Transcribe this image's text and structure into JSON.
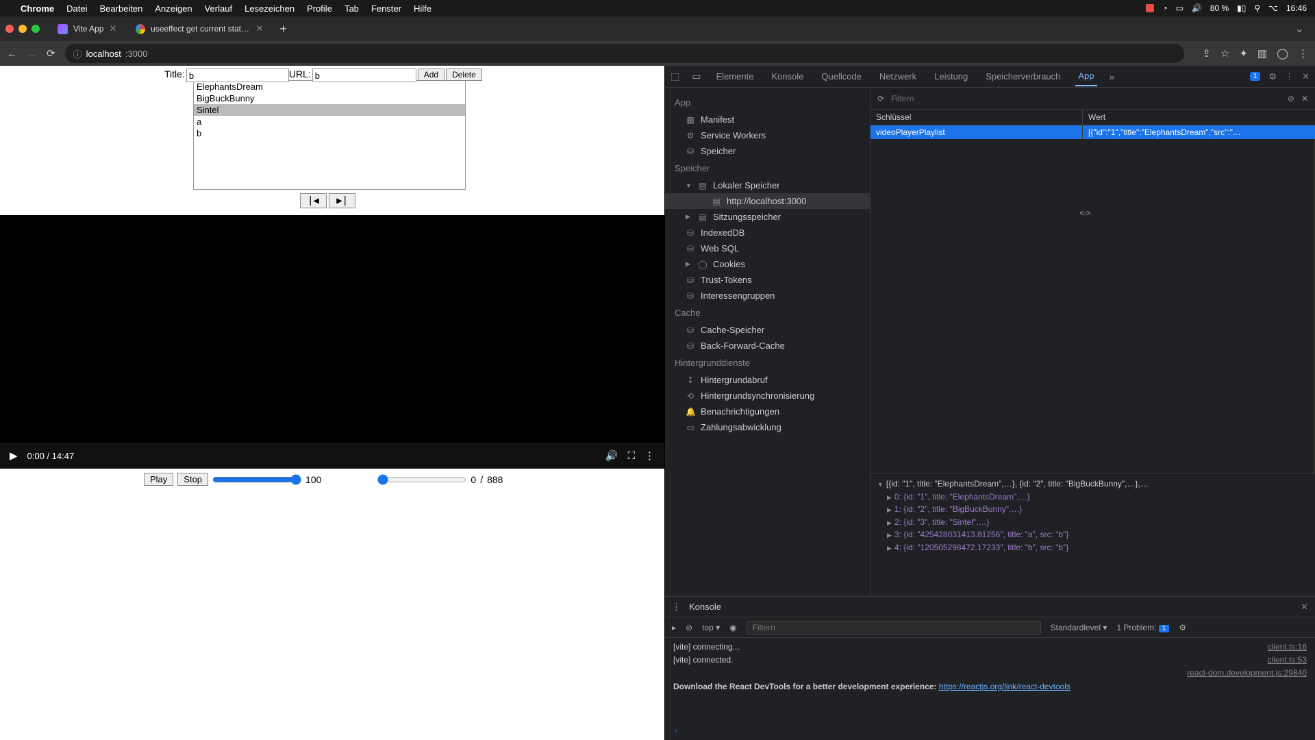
{
  "menubar": {
    "app": "Chrome",
    "items": [
      "Datei",
      "Bearbeiten",
      "Anzeigen",
      "Verlauf",
      "Lesezeichen",
      "Profile",
      "Tab",
      "Fenster",
      "Hilfe"
    ],
    "battery": "80 %",
    "time": "16:46"
  },
  "tabs": {
    "t1": "Vite App",
    "t2": "useeffect get current state - G"
  },
  "addr": {
    "host": "localhost",
    "port": ":3000"
  },
  "form": {
    "title_label": "Title:",
    "title_value": "b",
    "url_label": "URL:",
    "url_value": "b",
    "add": "Add",
    "delete": "Delete"
  },
  "list": {
    "items": [
      "ElephantsDream",
      "BigBuckBunny",
      "Sintel",
      "a",
      "b"
    ],
    "selected_index": 2
  },
  "nav": {
    "prev": "|◀",
    "next": "▶|"
  },
  "video": {
    "time": "0:00 / 14:47"
  },
  "player": {
    "play": "Play",
    "stop": "Stop",
    "vol_val": "100",
    "pos": "0",
    "dur": "888"
  },
  "devtabs": {
    "t0": "Elemente",
    "t1": "Konsole",
    "t2": "Quellcode",
    "t3": "Netzwerk",
    "t4": "Leistung",
    "t5": "Speicherverbrauch",
    "t6": "App",
    "issues": "1"
  },
  "app_sidebar": {
    "app_hdr": "App",
    "manifest": "Manifest",
    "sw": "Service Workers",
    "speicher": "Speicher",
    "speicher_hdr": "Speicher",
    "local": "Lokaler Speicher",
    "origin": "http://localhost:3000",
    "session": "Sitzungsspeicher",
    "idb": "IndexedDB",
    "websql": "Web SQL",
    "cookies": "Cookies",
    "trust": "Trust-Tokens",
    "interest": "Interessengruppen",
    "cache_hdr": "Cache",
    "cache": "Cache-Speicher",
    "bfc": "Back-Forward-Cache",
    "bg_hdr": "Hintergrunddienste",
    "fetch": "Hintergrundabruf",
    "sync": "Hintergrundsynchronisierung",
    "notif": "Benachrichtigungen",
    "pay": "Zahlungsabwicklung"
  },
  "kv": {
    "filter_ph": "Filtern",
    "key_hdr": "Schlüssel",
    "val_hdr": "Wert",
    "row_key": "videoPlayerPlaylist",
    "row_val": "[{\"id\":\"1\",\"title\":\"ElephantsDream\",\"src\":\"…"
  },
  "preview": {
    "l0": "[{id: \"1\", title: \"ElephantsDream\",…}, {id: \"2\", title: \"BigBuckBunny\",…},…",
    "l1": "0: {id: \"1\", title: \"ElephantsDream\",…}",
    "l2": "1: {id: \"2\", title: \"BigBuckBunny\",…}",
    "l3": "2: {id: \"3\", title: \"Sintel\",…}",
    "l4": "3: {id: \"425428031413.81256\", title: \"a\", src: \"b\"}",
    "l5": "4: {id: \"120505298472.17233\", title: \"b\", src: \"b\"}"
  },
  "drawer": {
    "tab": "Konsole",
    "ctx": "top",
    "filter_ph": "Filtern",
    "level": "Standardlevel",
    "prob_label": "1 Problem:",
    "prob_n": "1",
    "log0": "[vite] connecting...",
    "src0": "client.ts:16",
    "log1": "[vite] connected.",
    "src1": "client.ts:53",
    "src2": "react-dom.development.js:29840",
    "log2a": "Download the React DevTools for a better development experience: ",
    "log2b": "https://reactjs.org/link/react-devtools"
  }
}
